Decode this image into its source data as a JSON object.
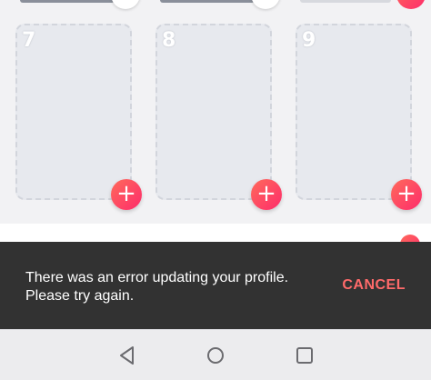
{
  "profile_grid": {
    "slots": [
      {
        "number": "7",
        "add_icon": "plus-icon"
      },
      {
        "number": "8",
        "add_icon": "plus-icon"
      },
      {
        "number": "9",
        "add_icon": "plus-icon"
      }
    ],
    "add_symbol": "+"
  },
  "snackbar": {
    "message_line1": "There was an error updating your profile.",
    "message_line2": "Please try again.",
    "action_label": "CANCEL"
  },
  "nav_bar": {
    "back_icon": "back-triangle-icon",
    "home_icon": "home-circle-icon",
    "recents_icon": "recents-square-icon"
  },
  "colors": {
    "accent_gradient_start": "#ff6a5b",
    "accent_gradient_end": "#fd2c6b",
    "snackbar_bg": "#323232",
    "snackbar_action": "#ff6a6a",
    "slot_bg": "#e7e9ee"
  }
}
